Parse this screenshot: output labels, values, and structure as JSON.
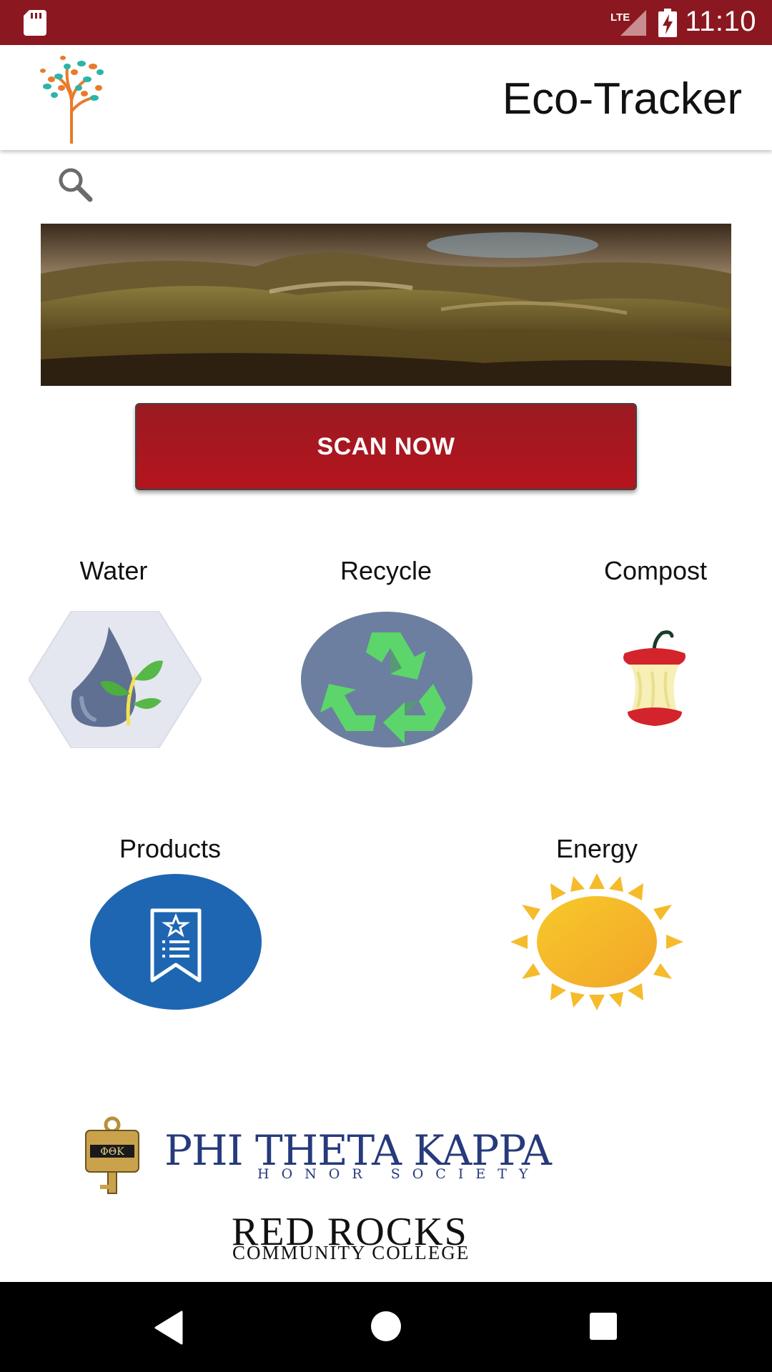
{
  "status_bar": {
    "time": "11:10",
    "network": "LTE",
    "icons": [
      "sd-card-icon",
      "lte-signal-icon",
      "battery-charging-icon"
    ]
  },
  "app_bar": {
    "title": "Eco-Tracker",
    "logo": "tree-logo-icon"
  },
  "search": {
    "icon": "search-icon"
  },
  "banner": {
    "description_icon": "landscape-banner-image"
  },
  "scan_button": {
    "label": "SCAN NOW"
  },
  "categories": [
    {
      "label": "Water",
      "icon": "water-drop-leaf-icon"
    },
    {
      "label": "Recycle",
      "icon": "recycle-icon"
    },
    {
      "label": "Compost",
      "icon": "apple-core-icon"
    },
    {
      "label": "Products",
      "icon": "product-list-icon"
    },
    {
      "label": "Energy",
      "icon": "sun-icon"
    }
  ],
  "sponsors": {
    "ptk_title": "PHI THETA KAPPA",
    "ptk_subtitle": "HONOR SOCIETY",
    "ptk_key_text": "ΦΘΚ",
    "rrcc_title": "RED ROCKS",
    "rrcc_subtitle": "COMMUNITY COLLEGE"
  },
  "nav_bar": {
    "buttons": [
      "back-icon",
      "home-icon",
      "recents-icon"
    ]
  },
  "colors": {
    "status_bar": "#8b1820",
    "scan_button": "#b5141d",
    "ptk_blue": "#263a7c",
    "products_blue": "#1e66b2",
    "recycle_bg": "#6c7fa0",
    "recycle_green": "#5cd56a",
    "sun_yellow": "#f5bb2a"
  }
}
